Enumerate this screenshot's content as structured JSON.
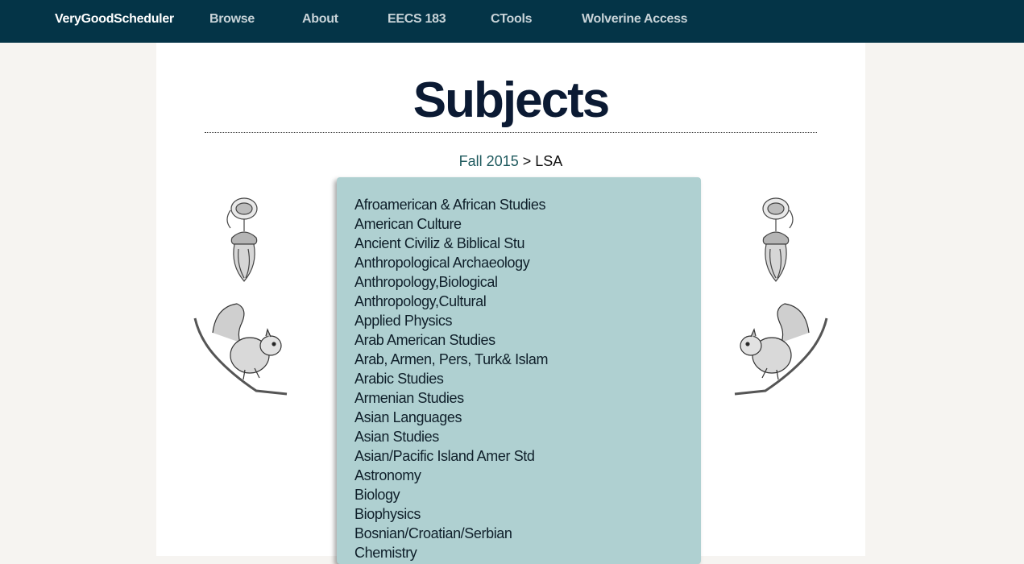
{
  "nav": {
    "brand": "VeryGoodScheduler",
    "items": [
      {
        "label": "Browse"
      },
      {
        "label": "About"
      },
      {
        "label": "EECS 183"
      },
      {
        "label": "CTools"
      },
      {
        "label": "Wolverine Access"
      }
    ]
  },
  "page": {
    "title": "Subjects",
    "breadcrumb": {
      "term": "Fall 2015",
      "separator": ">",
      "school": "LSA"
    }
  },
  "subjects": [
    "Afroamerican & African Studies",
    "American Culture",
    "Ancient Civiliz & Biblical Stu",
    "Anthropological Archaeology",
    "Anthropology,Biological",
    "Anthropology,Cultural",
    "Applied Physics",
    "Arab American Studies",
    "Arab, Armen, Pers, Turk& Islam",
    "Arabic Studies",
    "Armenian Studies",
    "Asian Languages",
    "Asian Studies",
    "Asian/Pacific Island Amer Std",
    "Astronomy",
    "Biology",
    "Biophysics",
    "Bosnian/Croatian/Serbian",
    "Chemistry"
  ],
  "colors": {
    "navbar": "#043447",
    "panel": "#afd0d1",
    "title": "#0b1a33",
    "link": "#1f5a5e"
  },
  "decorations": [
    "acorn-illustration",
    "squirrel-illustration"
  ]
}
